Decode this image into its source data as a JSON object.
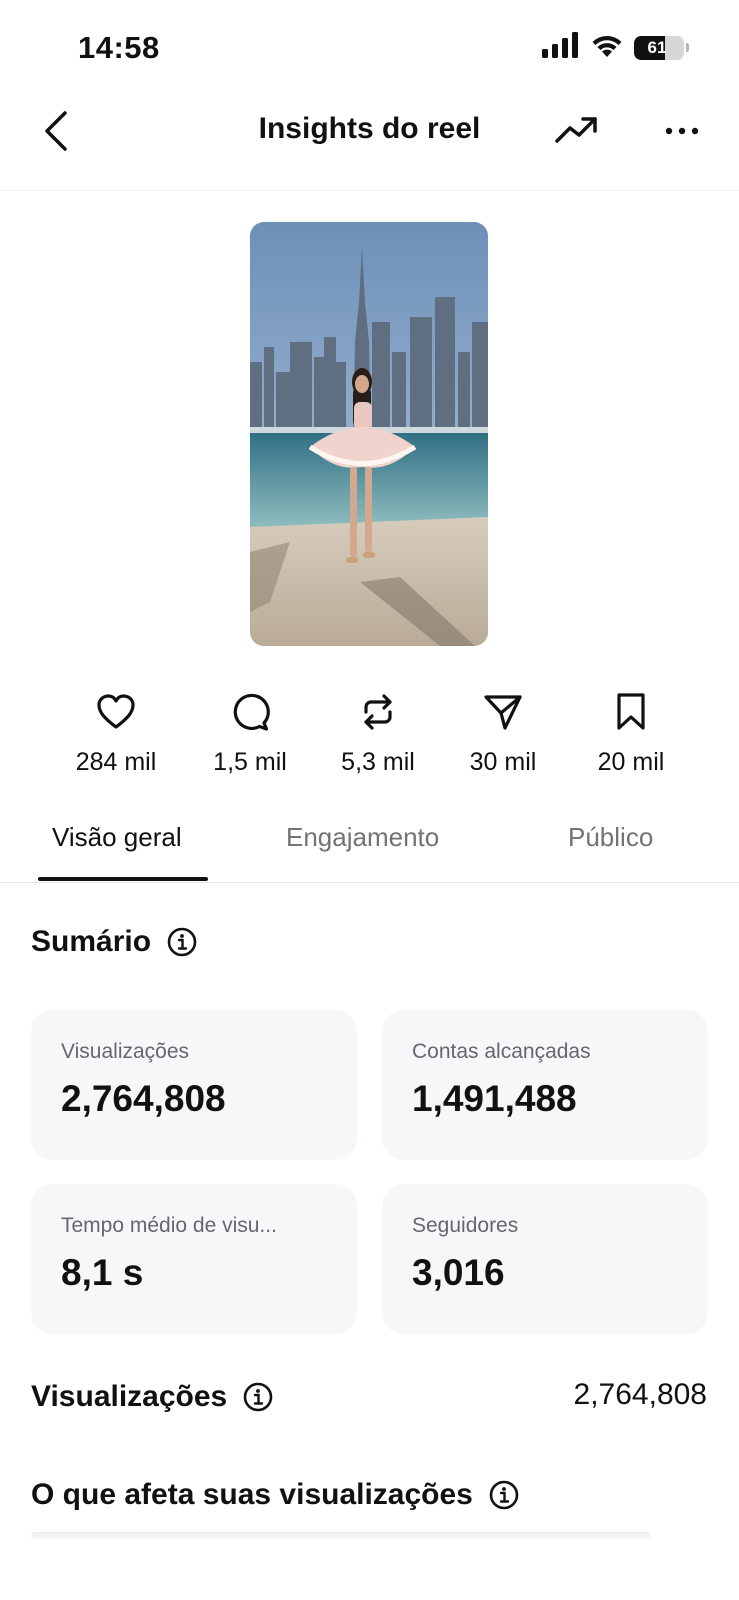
{
  "status_bar": {
    "time": "14:58",
    "battery": "61",
    "battery_level": 0.61
  },
  "header": {
    "title": "Insights do reel"
  },
  "reel": {
    "thumbnail_icon": "reel-thumbnail-image"
  },
  "metrics": [
    {
      "icon": "heart-icon",
      "value": "284 mil"
    },
    {
      "icon": "comment-icon",
      "value": "1,5 mil"
    },
    {
      "icon": "repost-icon",
      "value": "5,3 mil"
    },
    {
      "icon": "share-icon",
      "value": "30 mil"
    },
    {
      "icon": "bookmark-icon",
      "value": "20 mil"
    }
  ],
  "tabs": [
    {
      "label": "Visão geral",
      "active": true
    },
    {
      "label": "Engajamento",
      "active": false
    },
    {
      "label": "Público",
      "active": false
    }
  ],
  "summary": {
    "heading": "Sumário",
    "cards": [
      {
        "label": "Visualizações",
        "value": "2,764,808"
      },
      {
        "label": "Contas alcançadas",
        "value": "1,491,488"
      },
      {
        "label": "Tempo médio de visu...",
        "value": "8,1 s"
      },
      {
        "label": "Seguidores",
        "value": "3,016"
      }
    ]
  },
  "views_section": {
    "heading": "Visualizações",
    "total": "2,764,808"
  },
  "affects_section": {
    "heading": "O que afeta suas visualizações"
  }
}
